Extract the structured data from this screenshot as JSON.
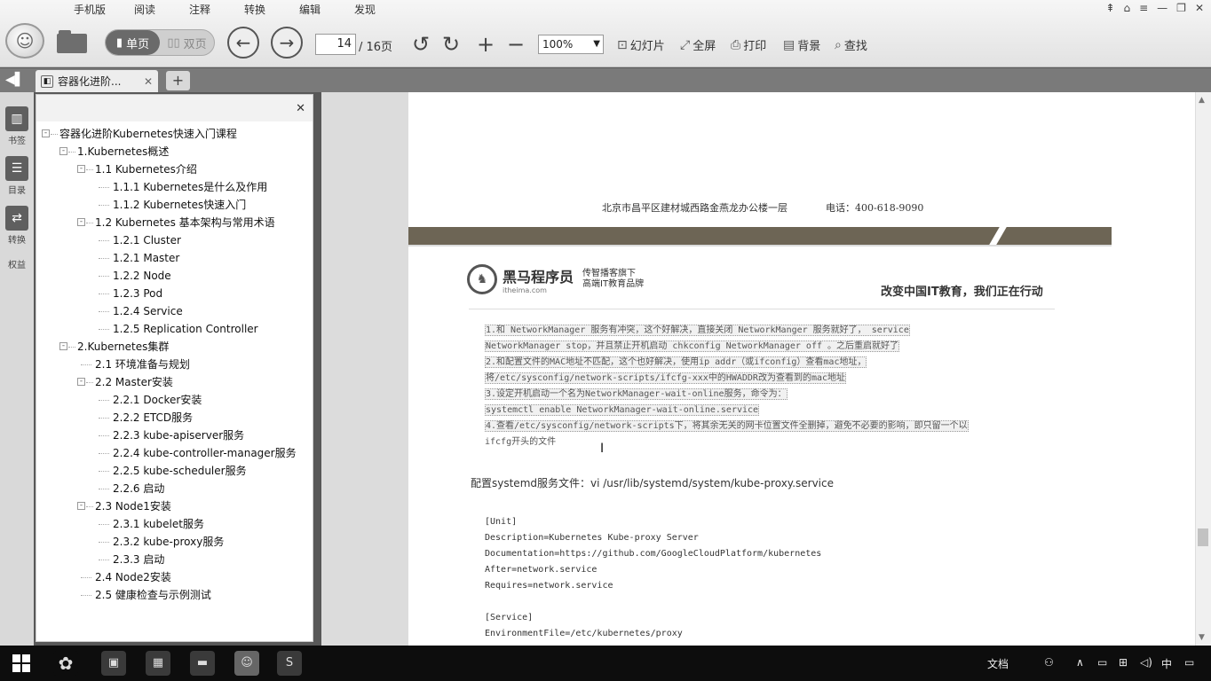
{
  "menu": [
    "手机版",
    "阅读",
    "注释",
    "转换",
    "编辑",
    "发现"
  ],
  "toolbar": {
    "single_page": "单页",
    "double_page": "双页",
    "current_page": "14",
    "total_pages": "/ 16页",
    "zoom": "100%",
    "slideshow": "幻灯片",
    "fullscreen": "全屏",
    "print": "打印",
    "background": "背景",
    "find": "查找"
  },
  "tab": {
    "title": "容器化进阶...",
    "close": "✕",
    "new": "+"
  },
  "rail": [
    "书签",
    "目录",
    "转换",
    "权益"
  ],
  "sidebar": {
    "close": "✕",
    "tree": [
      {
        "label": "容器化进阶Kubernetes快速入门课程",
        "level": 0,
        "toggle": "-"
      },
      {
        "label": "1.Kubernetes概述",
        "level": 1,
        "toggle": "-"
      },
      {
        "label": "1.1 Kubernetes介绍",
        "level": 2,
        "toggle": "-"
      },
      {
        "label": "1.1.1 Kubernetes是什么及作用",
        "level": 3,
        "toggle": ""
      },
      {
        "label": "1.1.2 Kubernetes快速入门",
        "level": 3,
        "toggle": ""
      },
      {
        "label": "1.2 Kubernetes 基本架构与常用术语",
        "level": 2,
        "toggle": "-"
      },
      {
        "label": "1.2.1 Cluster",
        "level": 3,
        "toggle": ""
      },
      {
        "label": "1.2.1 Master",
        "level": 3,
        "toggle": ""
      },
      {
        "label": "1.2.2 Node",
        "level": 3,
        "toggle": ""
      },
      {
        "label": "1.2.3 Pod",
        "level": 3,
        "toggle": ""
      },
      {
        "label": "1.2.4 Service",
        "level": 3,
        "toggle": ""
      },
      {
        "label": "1.2.5 Replication Controller",
        "level": 3,
        "toggle": ""
      },
      {
        "label": "2.Kubernetes集群",
        "level": 1,
        "toggle": "-"
      },
      {
        "label": "2.1 环境准备与规划",
        "level": 2,
        "toggle": ""
      },
      {
        "label": "2.2 Master安装",
        "level": 2,
        "toggle": "-"
      },
      {
        "label": "2.2.1 Docker安装",
        "level": 3,
        "toggle": ""
      },
      {
        "label": "2.2.2 ETCD服务",
        "level": 3,
        "toggle": ""
      },
      {
        "label": "2.2.3 kube-apiserver服务",
        "level": 3,
        "toggle": ""
      },
      {
        "label": "2.2.4 kube-controller-manager服务",
        "level": 3,
        "toggle": ""
      },
      {
        "label": "2.2.5 kube-scheduler服务",
        "level": 3,
        "toggle": ""
      },
      {
        "label": "2.2.6 启动",
        "level": 3,
        "toggle": ""
      },
      {
        "label": "2.3 Node1安装",
        "level": 2,
        "toggle": "-"
      },
      {
        "label": "2.3.1 kubelet服务",
        "level": 3,
        "toggle": ""
      },
      {
        "label": "2.3.2 kube-proxy服务",
        "level": 3,
        "toggle": ""
      },
      {
        "label": "2.3.3 启动",
        "level": 3,
        "toggle": ""
      },
      {
        "label": "2.4 Node2安装",
        "level": 2,
        "toggle": ""
      },
      {
        "label": "2.5 健康检查与示例测试",
        "level": 2,
        "toggle": ""
      }
    ]
  },
  "document": {
    "footer_address": "北京市昌平区建材城西路金燕龙办公楼一层",
    "footer_phone": "电话：400-618-9090",
    "brand_name": "黑马程序员",
    "brand_url": "itheima.com",
    "brand_sub1": "传智播客旗下",
    "brand_sub2": "高端IT教育品牌",
    "slogan": "改变中国IT教育，我们正在行动",
    "notes": [
      "1.和 NetworkManager 服务有冲突，这个好解决，直接关闭 NetworkManger 服务就好了， service",
      "NetworkManager stop，并且禁止开机启动 chkconfig NetworkManager off 。之后重启就好了",
      "2.和配置文件的MAC地址不匹配，这个也好解决，使用ip addr（或ifconfig）查看mac地址，",
      "将/etc/sysconfig/network-scripts/ifcfg-xxx中的HWADDR改为查看到的mac地址",
      "3.设定开机启动一个名为NetworkManager-wait-online服务，命令为：",
      "systemctl enable NetworkManager-wait-online.service",
      "4.查看/etc/sysconfig/network-scripts下，将其余无关的网卡位置文件全删掉，避免不必要的影响，即只留一个以",
      "ifcfg开头的文件"
    ],
    "config_title": "配置systemd服务文件：vi /usr/lib/systemd/system/kube-proxy.service",
    "code": [
      "[Unit]",
      "Description=Kubernetes Kube-proxy Server",
      "Documentation=https://github.com/GoogleCloudPlatform/kubernetes",
      "After=network.service",
      "Requires=network.service",
      "",
      "[Service]",
      "EnvironmentFile=/etc/kubernetes/proxy"
    ]
  },
  "taskbar": {
    "tray_doc": "文档",
    "ime": "中"
  }
}
